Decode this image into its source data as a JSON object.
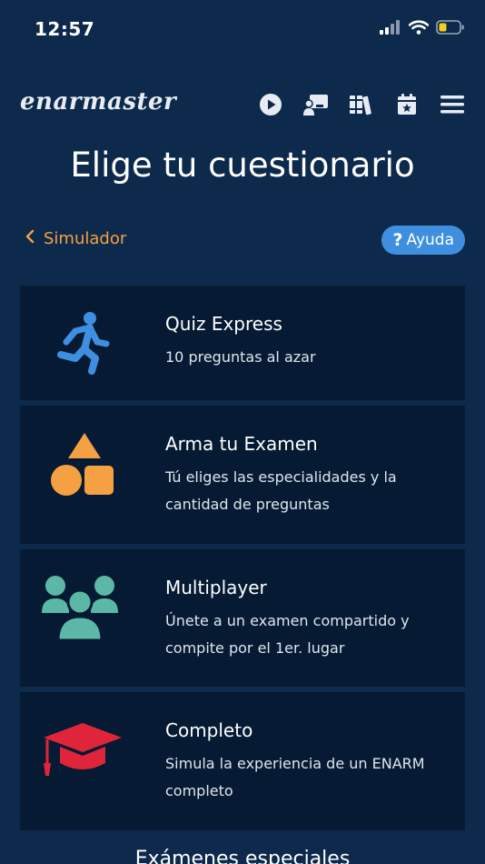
{
  "status_bar": {
    "time": "12:57"
  },
  "header": {
    "logo": "enarmaster",
    "nav_icons": [
      "play-icon",
      "presentation-icon",
      "library-icon",
      "calendar-star-icon",
      "menu-icon"
    ]
  },
  "page": {
    "title": "Elige tu cuestionario",
    "back_label": "Simulador",
    "help_label": "Ayuda"
  },
  "quizzes": [
    {
      "title": "Quiz Express",
      "desc": [
        "10 preguntas al azar"
      ],
      "icon": "running-person-icon",
      "color": "#3f8fe0"
    },
    {
      "title": "Arma tu Examen",
      "desc": [
        "Tú eliges las especialidades y la",
        "cantidad de preguntas"
      ],
      "icon": "shapes-icon",
      "color": "#f5a043"
    },
    {
      "title": "Multiplayer",
      "desc": [
        "Únete a un examen compartido y",
        "compite por el 1er. lugar"
      ],
      "icon": "group-icon",
      "color": "#5cb8a6"
    },
    {
      "title": "Completo",
      "desc": [
        "Simula la experiencia de un ENARM",
        "completo"
      ],
      "icon": "graduation-cap-icon",
      "color": "#e0253a"
    }
  ],
  "section": {
    "special_title": "Exámenes especiales"
  }
}
